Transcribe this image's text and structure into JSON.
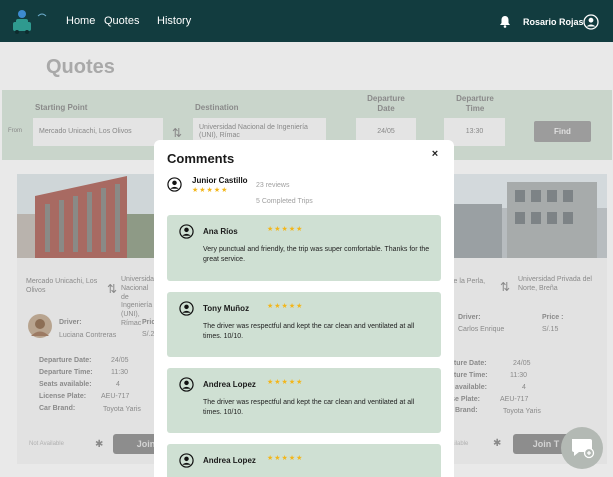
{
  "nav": {
    "links": [
      "Home",
      "Quotes",
      "History"
    ],
    "user_name": "Rosario Rojas"
  },
  "page": {
    "title": "Quotes",
    "search": {
      "starting_point_label": "Starting Point",
      "destination_label": "Destination",
      "departure_date_label": "Departure Date",
      "departure_time_label": "Departure Time",
      "from_label": "From",
      "starting_point_value": "Mercado Unicachi, Los Olivos",
      "destination_value": "Universidad Nacional de Ingeniería (UNI), Rímac",
      "date_value": "24/05",
      "time_value": "13:30",
      "find_label": "Find"
    },
    "cards": [
      {
        "origin": "Mercado Unicachi, Los Olivos",
        "destination": "Universidad Nacional de Ingeniería (UNI), Rímac",
        "driver_label": "Driver:",
        "driver_name": "Luciana Contreras",
        "price_label": "Price :",
        "price": "S/.2",
        "date_label": "Departure Date:",
        "date": "24/05",
        "time_label": "Departure Time:",
        "time": "11:30",
        "seats_label": "Seats available:",
        "seats": "4",
        "plate_label": "License Plate:",
        "plate": "AEU-717",
        "brand_label": "Car Brand:",
        "brand": "Toyota Yaris",
        "availability": "Not Available",
        "join_label": "Join"
      },
      {
        "origin": "le la Perla,",
        "destination": "Universidad Privada del Norte, Breña",
        "driver_label": "Driver:",
        "driver_name": "Carlos Enrique",
        "price_label": "Price :",
        "price": "S/.15",
        "date_label": "parture Date:",
        "date": "24/05",
        "time_label": "parture Time:",
        "time": "11:30",
        "seats_label": "ats available:",
        "seats": "4",
        "plate_label": "ense Plate:",
        "plate": "AEU-717",
        "brand_label": "Brand:",
        "brand": "Toyota Yaris",
        "availability": "ailable",
        "join_label": "Join T"
      }
    ]
  },
  "modal": {
    "title": "Comments",
    "close_glyph": "×",
    "driver": {
      "name": "Junior Castillo",
      "stars": "★★★★★",
      "reviews": "23 reviews",
      "trips": "5 Completed Trips"
    },
    "comments": [
      {
        "name": "Ana Ríos",
        "stars": "★★★★★",
        "text": "Very punctual and friendly, the trip was super comfortable. Thanks for the great service."
      },
      {
        "name": "Tony Muñoz",
        "stars": "★★★★★",
        "text": "The driver was respectful and kept the car clean and ventilated at all times. 10/10."
      },
      {
        "name": "Andrea Lopez",
        "stars": "★★★★★",
        "text": "The driver was respectful and kept the car clean and ventilated at all times. 10/10."
      },
      {
        "name": "Andrea Lopez",
        "stars": "★★★★★",
        "text": ""
      }
    ]
  },
  "colors": {
    "nav_bg": "#123c3f",
    "comment_bg": "#cfe0d3",
    "star": "#f2b61b"
  }
}
